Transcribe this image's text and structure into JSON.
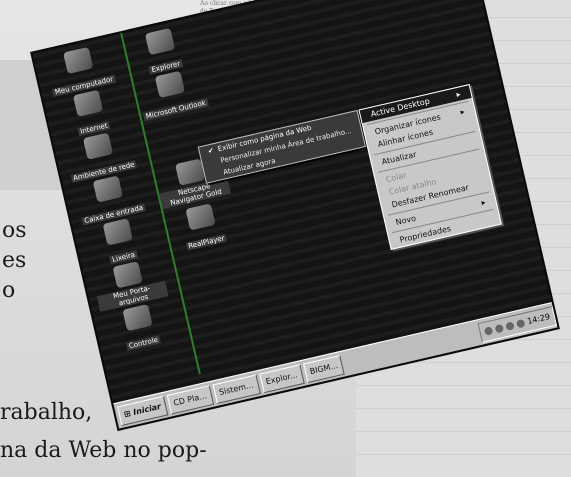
{
  "magazine": {
    "side_text": "Ao clicar com o botão direito do mouse sobre a Área de Trabalho, selecione Exibir como página da Web.",
    "caption_left_1": "os",
    "caption_left_2": "es",
    "caption_left_3": "o",
    "caption_line_1": "rabalho,",
    "caption_line_2": "na da Web no pop-"
  },
  "desktop": {
    "icons": [
      {
        "label": "Meu computador",
        "icon": "computer-icon"
      },
      {
        "label": "Explorer",
        "icon": "explorer-icon"
      },
      {
        "label": "Internet",
        "icon": "internet-icon"
      },
      {
        "label": "Microsoft Outlook",
        "icon": "outlook-icon"
      },
      {
        "label": "Ambiente de rede",
        "icon": "network-icon"
      },
      {
        "label": "Caixa de entrada",
        "icon": "inbox-icon"
      },
      {
        "label": "Netscape Navigator Gold",
        "icon": "netscape-icon"
      },
      {
        "label": "Lixeira",
        "icon": "recycle-bin-icon"
      },
      {
        "label": "RealPlayer",
        "icon": "realplayer-icon"
      },
      {
        "label": "Meu Porta-arquivos",
        "icon": "briefcase-icon"
      },
      {
        "label": "Controle",
        "icon": "control-icon"
      }
    ]
  },
  "submenu": {
    "items": [
      {
        "label": "Exibir como página da Web",
        "checked": true
      },
      {
        "label": "Personalizar minha Área de trabalho...",
        "checked": false
      },
      {
        "label": "Atualizar agora",
        "checked": false
      }
    ]
  },
  "context_menu": {
    "items": [
      {
        "label": "Active Desktop",
        "type": "selected"
      },
      {
        "label": "Organizar ícones",
        "type": "item"
      },
      {
        "label": "Alinhar ícones",
        "type": "item"
      },
      {
        "label": "Atualizar",
        "type": "item"
      },
      {
        "label": "Colar",
        "type": "disabled"
      },
      {
        "label": "Colar atalho",
        "type": "disabled"
      },
      {
        "label": "Desfazer Renomear",
        "type": "item"
      },
      {
        "label": "Novo",
        "type": "item"
      },
      {
        "label": "Propriedades",
        "type": "item"
      }
    ]
  },
  "taskbar": {
    "start_label": "Iniciar",
    "buttons": [
      "CD Pla...",
      "Sistem...",
      "Explor...",
      "BIGM..."
    ],
    "clock": "14:29"
  }
}
